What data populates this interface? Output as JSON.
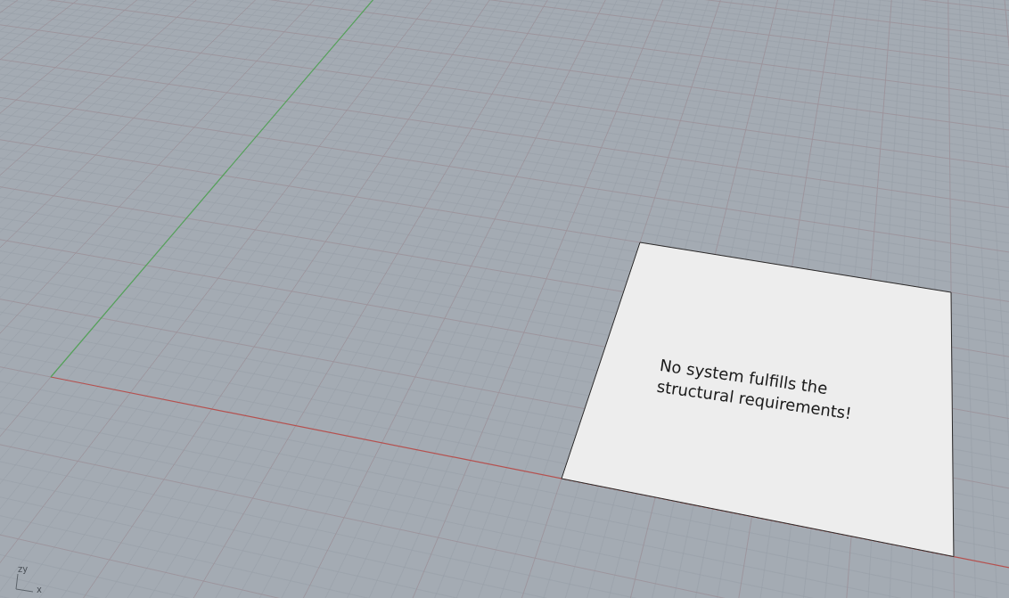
{
  "viewport": {
    "panel": {
      "message": "No system fulfills the structural requirements!"
    },
    "axis_widget": {
      "vertical_label": "zy",
      "horizontal_label": "x"
    }
  }
}
